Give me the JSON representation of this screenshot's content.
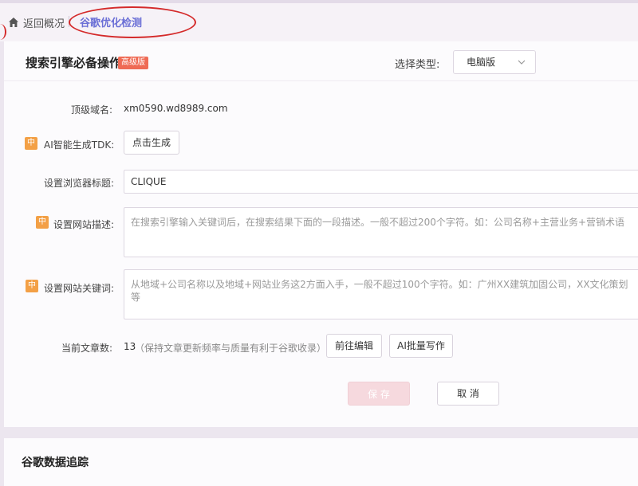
{
  "breadcrumb": {
    "back_label": "返回概况",
    "current": "谷歌优化检测"
  },
  "section": {
    "title": "搜索引擎必备操作",
    "badge": "高级版",
    "type_label": "选择类型:",
    "type_value": "电脑版"
  },
  "form": {
    "domain_label": "顶级域名:",
    "domain_value": "xm0590.wd8989.com",
    "ai_tag": "中",
    "tdk_label": "AI智能生成TDK:",
    "tdk_button": "点击生成",
    "title_label": "设置浏览器标题:",
    "title_value": "CLIQUE",
    "desc_label": "设置网站描述:",
    "desc_placeholder": "在搜索引擎输入关键词后，在搜索结果下面的一段描述。一般不超过200个字符。如：公司名称+主营业务+营销术语",
    "keywords_label": "设置网站关键词:",
    "keywords_placeholder": "从地域+公司名称以及地域+网站业务这2方面入手，一般不超过100个字符。如：广州XX建筑加固公司，XX文化策划等",
    "articles_label": "当前文章数:",
    "articles_count": "13",
    "articles_note": "（保持文章更新频率与质量有利于谷歌收录）",
    "edit_button": "前往编辑",
    "ai_write_button": "AI批量写作"
  },
  "actions": {
    "save": "保 存",
    "cancel": "取 消"
  },
  "section2": {
    "title": "谷歌数据追踪"
  },
  "colors": {
    "accent": "#6b6fd6",
    "badge": "#ef6b55",
    "ai_tag": "#f3a046",
    "annotation": "#d42a2a"
  }
}
